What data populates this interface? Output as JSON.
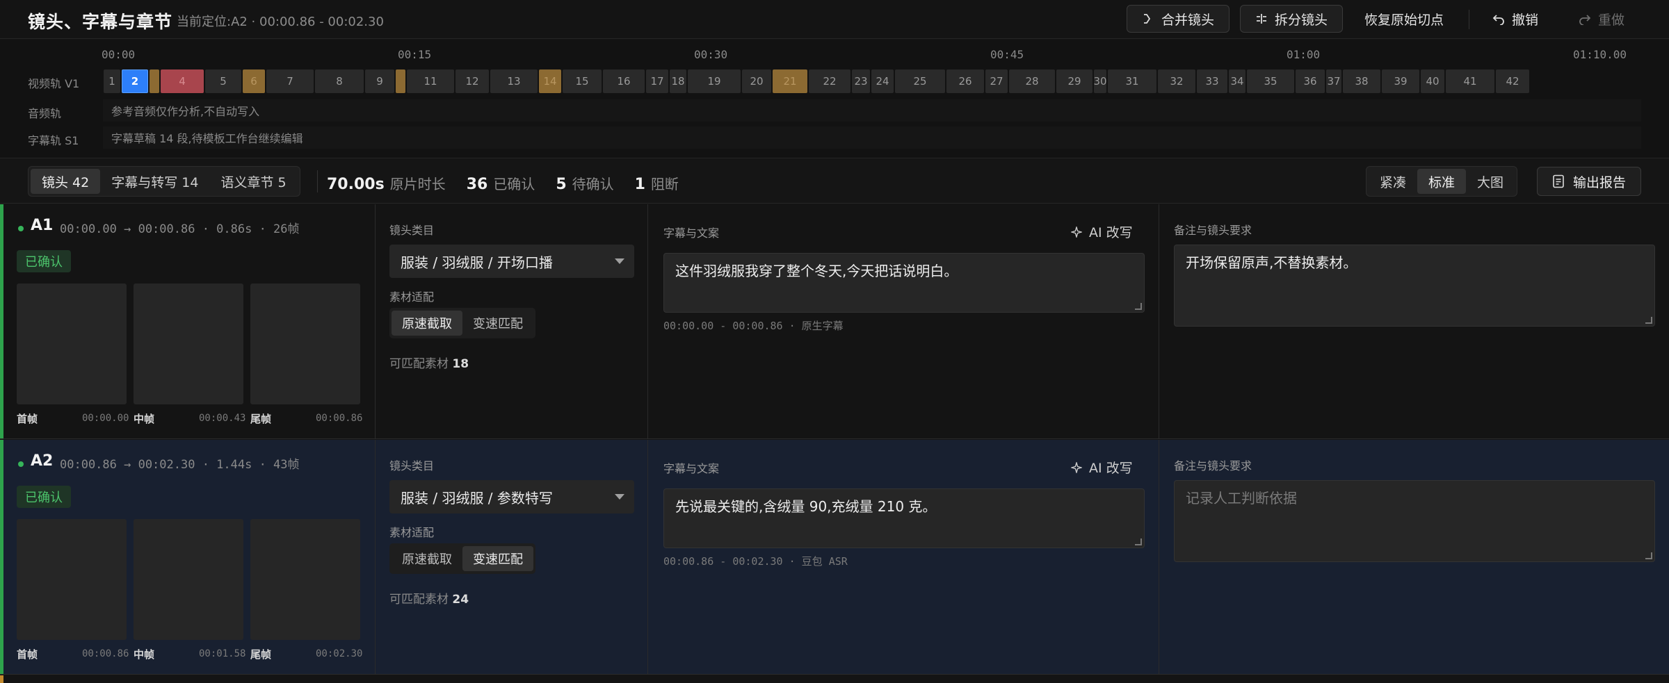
{
  "header": {
    "title": "镜头、字幕与章节",
    "location_label": "当前定位:A2 · 00:00.86 - 00:02.30",
    "merge_label": "合并镜头",
    "split_label": "拆分镜头",
    "restore_label": "恢复原始切点",
    "undo_label": "撤销",
    "redo_label": "重做"
  },
  "timeline": {
    "ticks": [
      "00:00",
      "00:15",
      "00:30",
      "00:45",
      "01:00",
      "01:10.00"
    ],
    "tracks": {
      "video_label": "视频轨 V1",
      "audio_label": "音频轨",
      "audio_text": "参考音频仅作分析,不自动写入",
      "subtitle_label": "字幕轨 S1",
      "subtitle_text": "字幕草稿 14 段,待模板工作台继续编辑"
    },
    "segments": [
      {
        "label": "1",
        "state": "normal"
      },
      {
        "label": "2",
        "state": "selected"
      },
      {
        "label": "",
        "state": "warn"
      },
      {
        "label": "4",
        "state": "error"
      },
      {
        "label": "5",
        "state": "normal"
      },
      {
        "label": "6",
        "state": "warn"
      },
      {
        "label": "7",
        "state": "normal"
      },
      {
        "label": "8",
        "state": "normal"
      },
      {
        "label": "9",
        "state": "normal"
      },
      {
        "label": "",
        "state": "warn"
      },
      {
        "label": "11",
        "state": "normal"
      },
      {
        "label": "12",
        "state": "normal"
      },
      {
        "label": "13",
        "state": "normal"
      },
      {
        "label": "14",
        "state": "warn"
      },
      {
        "label": "15",
        "state": "normal"
      },
      {
        "label": "16",
        "state": "normal"
      },
      {
        "label": "17",
        "state": "normal"
      },
      {
        "label": "18",
        "state": "normal"
      },
      {
        "label": "19",
        "state": "normal"
      },
      {
        "label": "20",
        "state": "normal"
      },
      {
        "label": "21",
        "state": "warn"
      },
      {
        "label": "22",
        "state": "normal"
      },
      {
        "label": "23",
        "state": "normal"
      },
      {
        "label": "24",
        "state": "normal"
      },
      {
        "label": "25",
        "state": "normal"
      },
      {
        "label": "26",
        "state": "normal"
      },
      {
        "label": "27",
        "state": "normal"
      },
      {
        "label": "28",
        "state": "normal"
      },
      {
        "label": "29",
        "state": "normal"
      },
      {
        "label": "30",
        "state": "normal"
      },
      {
        "label": "31",
        "state": "normal"
      },
      {
        "label": "32",
        "state": "normal"
      },
      {
        "label": "33",
        "state": "normal"
      },
      {
        "label": "34",
        "state": "normal"
      },
      {
        "label": "35",
        "state": "normal"
      },
      {
        "label": "36",
        "state": "normal"
      },
      {
        "label": "37",
        "state": "normal"
      },
      {
        "label": "38",
        "state": "normal"
      },
      {
        "label": "39",
        "state": "normal"
      },
      {
        "label": "40",
        "state": "normal"
      },
      {
        "label": "41",
        "state": "normal"
      },
      {
        "label": "42",
        "state": "normal"
      }
    ]
  },
  "toolbar": {
    "tabs": [
      "镜头 42",
      "字幕与转写 14",
      "语义章节 5"
    ],
    "active_tab": "镜头 42",
    "duration_value": "70.00s",
    "duration_label": "原片时长",
    "confirmed_value": "36",
    "confirmed_label": "已确认",
    "pending_value": "5",
    "pending_label": "待确认",
    "blocked_value": "1",
    "blocked_label": "阻断",
    "density": [
      "紧凑",
      "标准",
      "大图"
    ],
    "active_density": "标准",
    "report_label": "输出报告"
  },
  "shots": [
    {
      "id": "A1",
      "meta": "00:00.00 → 00:00.86 · 0.86s · 26帧",
      "status": "已确认",
      "frames": [
        {
          "label": "首帧",
          "time": "00:00.00"
        },
        {
          "label": "中帧",
          "time": "00:00.43"
        },
        {
          "label": "尾帧",
          "time": "00:00.86"
        }
      ],
      "category_label": "镜头类目",
      "category": "服装 / 羽绒服 / 开场口播",
      "match_label": "素材适配",
      "match_options": [
        "原速截取",
        "变速匹配"
      ],
      "match_active": "原速截取",
      "match_count_label": "可匹配素材",
      "match_count": "18",
      "caption_label": "字幕与文案",
      "ai_label": "AI 改写",
      "caption": "这件羽绒服我穿了整个冬天,今天把话说明白。",
      "caption_meta": "00:00.00 - 00:00.86 · 原生字幕",
      "notes_label": "备注与镜头要求",
      "notes": "开场保留原声,不替换素材。",
      "notes_placeholder": ""
    },
    {
      "id": "A2",
      "meta": "00:00.86 → 00:02.30 · 1.44s · 43帧",
      "status": "已确认",
      "frames": [
        {
          "label": "首帧",
          "time": "00:00.86"
        },
        {
          "label": "中帧",
          "time": "00:01.58"
        },
        {
          "label": "尾帧",
          "time": "00:02.30"
        }
      ],
      "category_label": "镜头类目",
      "category": "服装 / 羽绒服 / 参数特写",
      "match_label": "素材适配",
      "match_options": [
        "原速截取",
        "变速匹配"
      ],
      "match_active": "变速匹配",
      "match_count_label": "可匹配素材",
      "match_count": "24",
      "caption_label": "字幕与文案",
      "ai_label": "AI 改写",
      "caption": "先说最关键的,含绒量 90,充绒量 210 克。",
      "caption_meta": "00:00.86 - 00:02.30 · 豆包 ASR",
      "notes_label": "备注与镜头要求",
      "notes": "",
      "notes_placeholder": "记录人工判断依据"
    }
  ],
  "colors": {
    "selected": "#2d7ff9",
    "warn": "#8c6a32",
    "error": "#a8454d",
    "confirmed": "#36b45a",
    "active_row": "#182030"
  }
}
